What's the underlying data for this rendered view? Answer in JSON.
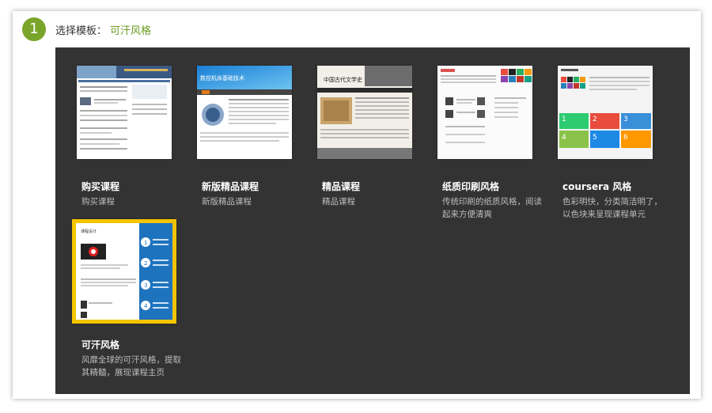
{
  "step": {
    "number": "1",
    "label": "选择模板：",
    "value": "可汗风格"
  },
  "thumb_text": {
    "t2_header": "数控机床基础技术",
    "t3_header": "中国古代文学史",
    "t6_title": "课程设计",
    "t6_nums": [
      "1",
      "2",
      "3",
      "4"
    ],
    "t5_nums": [
      "1",
      "2",
      "3",
      "4",
      "5",
      "6"
    ]
  },
  "templates": [
    {
      "name": "购买课程",
      "desc": "购买课程"
    },
    {
      "name": "新版精品课程",
      "desc": "新版精品课程"
    },
    {
      "name": "精品课程",
      "desc": "精品课程"
    },
    {
      "name": "纸质印刷风格",
      "desc": "传统印刷的纸质风格，阅读起来方便清爽"
    },
    {
      "name": "coursera 风格",
      "desc": "色彩明快，分类简洁明了，以色块来呈现课程单元"
    },
    {
      "name": "可汗风格",
      "desc": "风靡全球的可汗风格，提取其精髓，展现课程主页"
    }
  ],
  "colors": {
    "accent_green": "#7aa52b",
    "panel_bg": "#333333",
    "selected_border": "#f5c400",
    "khan_blue": "#1e73be"
  }
}
